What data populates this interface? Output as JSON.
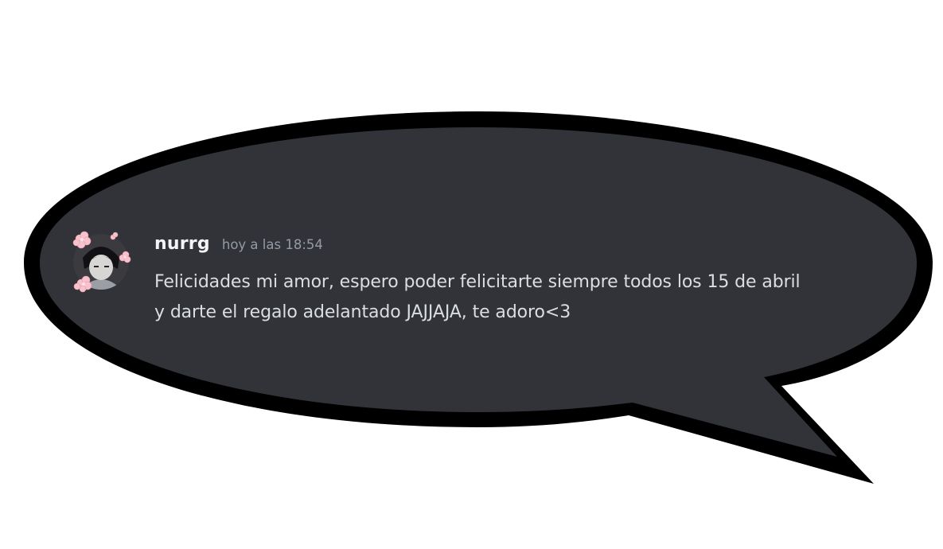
{
  "message": {
    "author": {
      "username": "nurrg",
      "avatar_icon": "user-avatar-sakura-frame"
    },
    "timestamp": "hoy a las 18:54",
    "content_lines": [
      "Felicidades mi amor, espero poder felicitarte siempre todos los 15 de abril",
      "y darte el regalo adelantado JAJJAJA, te adoro<3"
    ]
  },
  "colors": {
    "bubble_fill": "#313338",
    "bubble_outline": "#000000",
    "username": "#f2f3f5",
    "timestamp": "#949ba4",
    "text": "#dbdee1",
    "sakura": "#f7c2cc"
  }
}
